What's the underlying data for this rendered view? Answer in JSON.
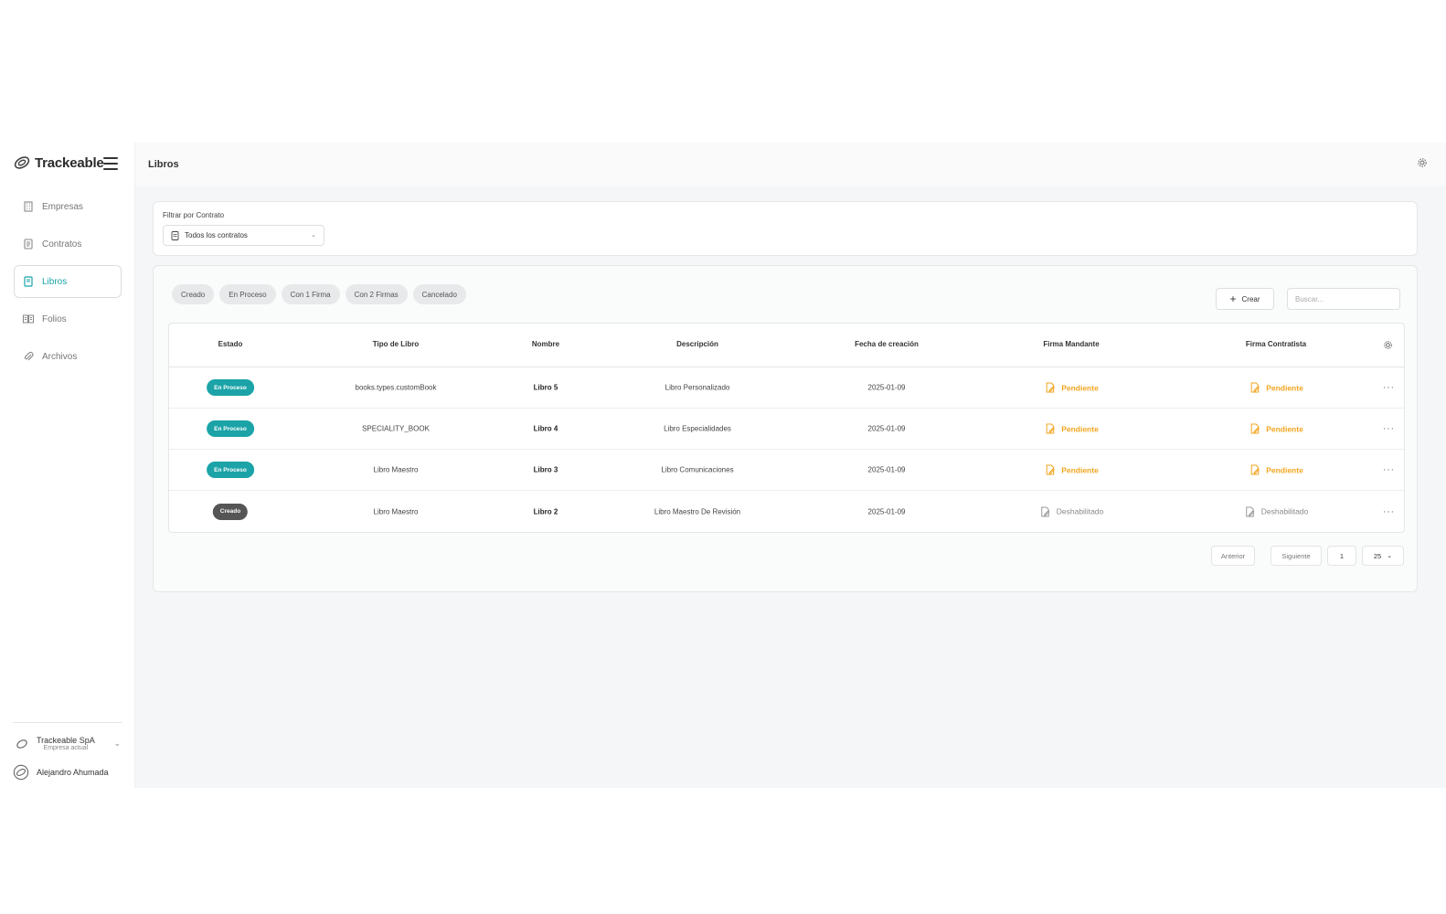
{
  "brand": {
    "name": "Trackeable"
  },
  "sidebar": {
    "items": [
      {
        "label": "Empresas",
        "icon": "building-icon",
        "active": false
      },
      {
        "label": "Contratos",
        "icon": "contract-icon",
        "active": false
      },
      {
        "label": "Libros",
        "icon": "book-icon",
        "active": true
      },
      {
        "label": "Folios",
        "icon": "folio-icon",
        "active": false
      },
      {
        "label": "Archivos",
        "icon": "paperclip-icon",
        "active": false
      }
    ],
    "company": {
      "name": "Trackeable SpA",
      "subtitle": "Empresa actual"
    },
    "user": {
      "name": "Alejandro Ahumada"
    }
  },
  "header": {
    "title": "Libros"
  },
  "filter": {
    "label": "Filtrar por Contrato",
    "selected": "Todos los contratos"
  },
  "chips": [
    "Creado",
    "En Proceso",
    "Con 1 Firma",
    "Con 2 Firmas",
    "Cancelado"
  ],
  "toolbar": {
    "create_label": "Crear",
    "search_placeholder": "Buscar..."
  },
  "table": {
    "headers": [
      "Estado",
      "Tipo de Libro",
      "Nombre",
      "Descripción",
      "Fecha de creación",
      "Firma Mandante",
      "Firma Contratista"
    ],
    "rows": [
      {
        "status": "En Proceso",
        "status_kind": "proc",
        "type": "books.types.customBook",
        "name": "Libro 5",
        "description": "Libro Personalizado",
        "date": "2025-01-09",
        "mandante": "Pendiente",
        "mandante_kind": "pend",
        "contratista": "Pendiente",
        "contratista_kind": "pend"
      },
      {
        "status": "En Proceso",
        "status_kind": "proc",
        "type": "SPECIALITY_BOOK",
        "name": "Libro 4",
        "description": "Libro Especialidades",
        "date": "2025-01-09",
        "mandante": "Pendiente",
        "mandante_kind": "pend",
        "contratista": "Pendiente",
        "contratista_kind": "pend"
      },
      {
        "status": "En Proceso",
        "status_kind": "proc",
        "type": "Libro Maestro",
        "name": "Libro 3",
        "description": "Libro Comunicaciones",
        "date": "2025-01-09",
        "mandante": "Pendiente",
        "mandante_kind": "pend",
        "contratista": "Pendiente",
        "contratista_kind": "pend"
      },
      {
        "status": "Creado",
        "status_kind": "cread",
        "type": "Libro Maestro",
        "name": "Libro 2",
        "description": "Libro Maestro De Revisión",
        "date": "2025-01-09",
        "mandante": "Deshabilitado",
        "mandante_kind": "dis",
        "contratista": "Deshabilitado",
        "contratista_kind": "dis"
      }
    ]
  },
  "pagination": {
    "prev_label": "Anterior",
    "next_label": "Siguiente",
    "page": "1",
    "page_size": "25"
  },
  "colors": {
    "accent": "#1ba3a8",
    "pending": "#f2a51f",
    "created": "#555555"
  }
}
